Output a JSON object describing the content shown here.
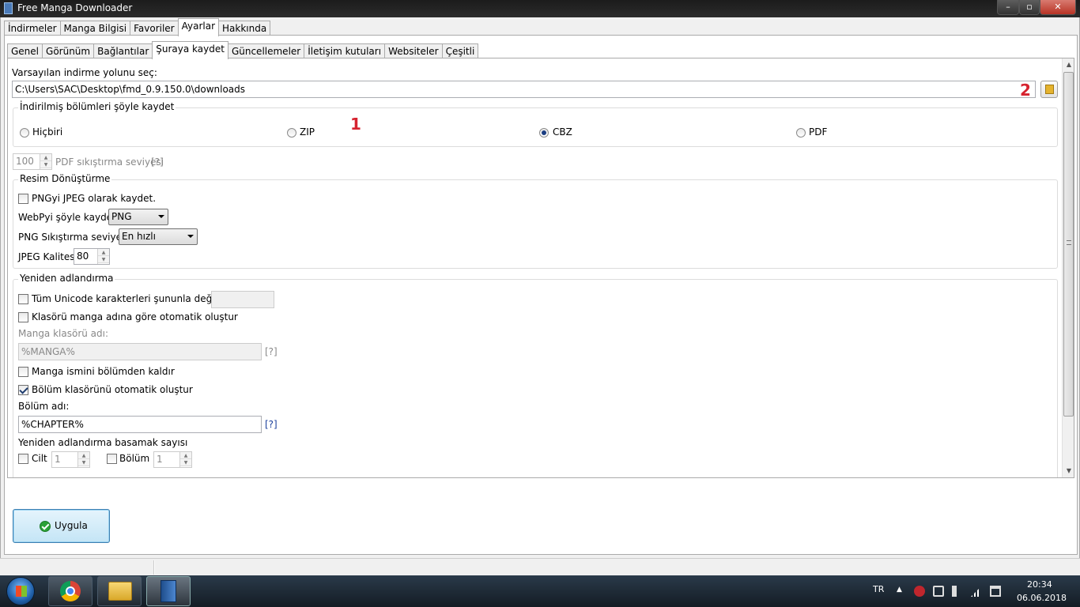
{
  "window": {
    "title": "Free Manga Downloader",
    "min_glyph": "–",
    "max_glyph": "▫",
    "close_glyph": "✕"
  },
  "main_tabs": [
    {
      "label": "İndirmeler"
    },
    {
      "label": "Manga Bilgisi"
    },
    {
      "label": "Favoriler"
    },
    {
      "label": "Ayarlar"
    },
    {
      "label": "Hakkında"
    }
  ],
  "sub_tabs": [
    {
      "label": "Genel"
    },
    {
      "label": "Görünüm"
    },
    {
      "label": "Bağlantılar"
    },
    {
      "label": "Şuraya kaydet"
    },
    {
      "label": "Güncellemeler"
    },
    {
      "label": "İletişim kutuları"
    },
    {
      "label": "Websiteler"
    },
    {
      "label": "Çeşitli"
    }
  ],
  "save": {
    "path_label": "Varsayılan indirme yolunu seç:",
    "path_value": "C:\\Users\\SAC\\Desktop\\fmd_0.9.150.0\\downloads",
    "format_group": "İndirilmiş bölümleri şöyle kaydet",
    "formats": [
      "Hiçbiri",
      "ZIP",
      "CBZ",
      "PDF"
    ],
    "selected_format": "CBZ",
    "pdf_level_value": "100",
    "pdf_level_label": "PDF sıkıştırma seviyesi",
    "pdf_help": "[?]"
  },
  "conversion": {
    "group": "Resim Dönüştürme",
    "png_to_jpeg": "PNGyi JPEG olarak kaydet.",
    "webp_label": "WebPyi şöyle kaydet",
    "webp_value": "PNG",
    "png_level_label": "PNG Sıkıştırma seviyesi",
    "png_level_value": "En hızlı",
    "jpeg_label": "JPEG Kalitesi",
    "jpeg_value": "80"
  },
  "rename": {
    "group": "Yeniden adlandırma",
    "unicode_label": "Tüm Unicode karakterleri şununla değiştir",
    "auto_folder_label": "Klasörü manga adına göre otomatik oluştur",
    "manga_folder_label": "Manga klasörü adı:",
    "manga_folder_value": "%MANGA%",
    "help1": "[?]",
    "remove_name_label": "Manga ismini bölümden kaldır",
    "auto_chapter_label": "Bölüm klasörünü otomatik oluştur",
    "chapter_name_label": "Bölüm adı:",
    "chapter_name_value": "%CHAPTER%",
    "help2": "[?]",
    "digits_label": "Yeniden adlandırma basamak sayısı",
    "volume_label": "Cilt",
    "volume_value": "1",
    "chapter_label": "Bölüm",
    "chapter_value": "1"
  },
  "annotations": {
    "one": "1",
    "two": "2"
  },
  "apply_label": "Uygula",
  "taskbar": {
    "lang": "TR",
    "time": "20:34",
    "date": "06.06.2018",
    "tray_up": "▲"
  },
  "colors": {
    "annotation": "#d6232f",
    "link": "#1a3f9c",
    "apply_border": "#3c7fb1"
  }
}
